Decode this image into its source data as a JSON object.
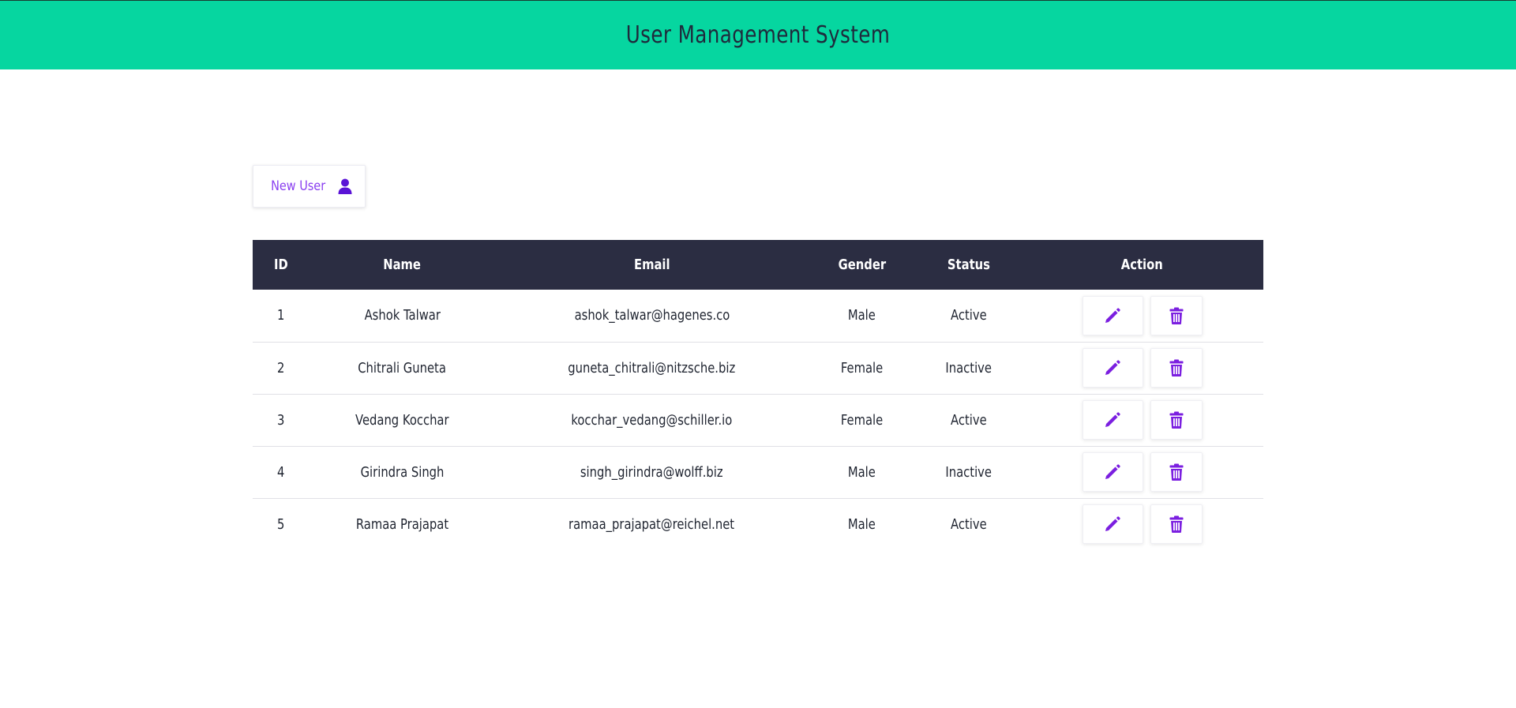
{
  "header": {
    "title": "User Management System"
  },
  "toolbar": {
    "new_user_label": "New User",
    "new_user_icon": "user-icon"
  },
  "table": {
    "columns": [
      "ID",
      "Name",
      "Email",
      "Gender",
      "Status",
      "Action"
    ],
    "rows": [
      {
        "id": "1",
        "name": "Ashok Talwar",
        "email": "ashok_talwar@hagenes.co",
        "gender": "Male",
        "status": "Active"
      },
      {
        "id": "2",
        "name": "Chitrali Guneta",
        "email": "guneta_chitrali@nitzsche.biz",
        "gender": "Female",
        "status": "Inactive"
      },
      {
        "id": "3",
        "name": "Vedang Kocchar",
        "email": "kocchar_vedang@schiller.io",
        "gender": "Female",
        "status": "Active"
      },
      {
        "id": "4",
        "name": "Girindra Singh",
        "email": "singh_girindra@wolff.biz",
        "gender": "Male",
        "status": "Inactive"
      },
      {
        "id": "5",
        "name": "Ramaa Prajapat",
        "email": "ramaa_prajapat@reichel.net",
        "gender": "Male",
        "status": "Active"
      }
    ],
    "action_icons": [
      "pencil-icon",
      "trash-icon"
    ]
  },
  "colors": {
    "header_bg": "#06d6a0",
    "table_header_bg": "#2b2d42",
    "accent": "#7b1fe0"
  }
}
